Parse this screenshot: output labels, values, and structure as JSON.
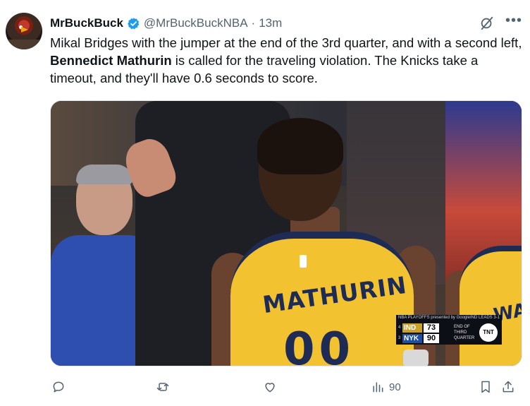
{
  "author": {
    "display_name": "MrBuckBuck",
    "handle": "@MrBuckBuckNBA",
    "separator": "·",
    "time": "13m",
    "verified_icon": "verified-badge-icon",
    "verified_color": "#1d9bf0"
  },
  "tweet": {
    "text_before": "Mikal Bridges with the jumper at the end of the 3rd quarter, and with a second left, ",
    "text_bold": "Bennedict Mathurin",
    "text_after": " is called for the traveling violation. The Knicks take a timeout, and they'll have 0.6 seconds to score."
  },
  "media": {
    "jersey_name": "MATHURIN",
    "jersey_number": "00",
    "teammate_jersey": "WALK",
    "jersey_color": "#f2c230",
    "scorebug": {
      "header_left": "NBA PLAYOFFS presented by Google",
      "header_right": "IND LEADS 3-1",
      "team1_seed": "4",
      "team1": "IND",
      "team1_score": "73",
      "team2_seed": "3",
      "team2": "NYK",
      "team2_score": "90",
      "period_line1": "END OF",
      "period_line2": "THIRD",
      "period_line3": "QUARTER",
      "network": "TNT"
    }
  },
  "actions": {
    "reply_icon": "reply-icon",
    "repost_icon": "repost-icon",
    "like_icon": "like-icon",
    "views_icon": "views-icon",
    "views_count": "90",
    "bookmark_icon": "bookmark-icon",
    "share_icon": "share-icon"
  },
  "colors": {
    "text_primary": "#0f1419",
    "text_secondary": "#536471"
  }
}
